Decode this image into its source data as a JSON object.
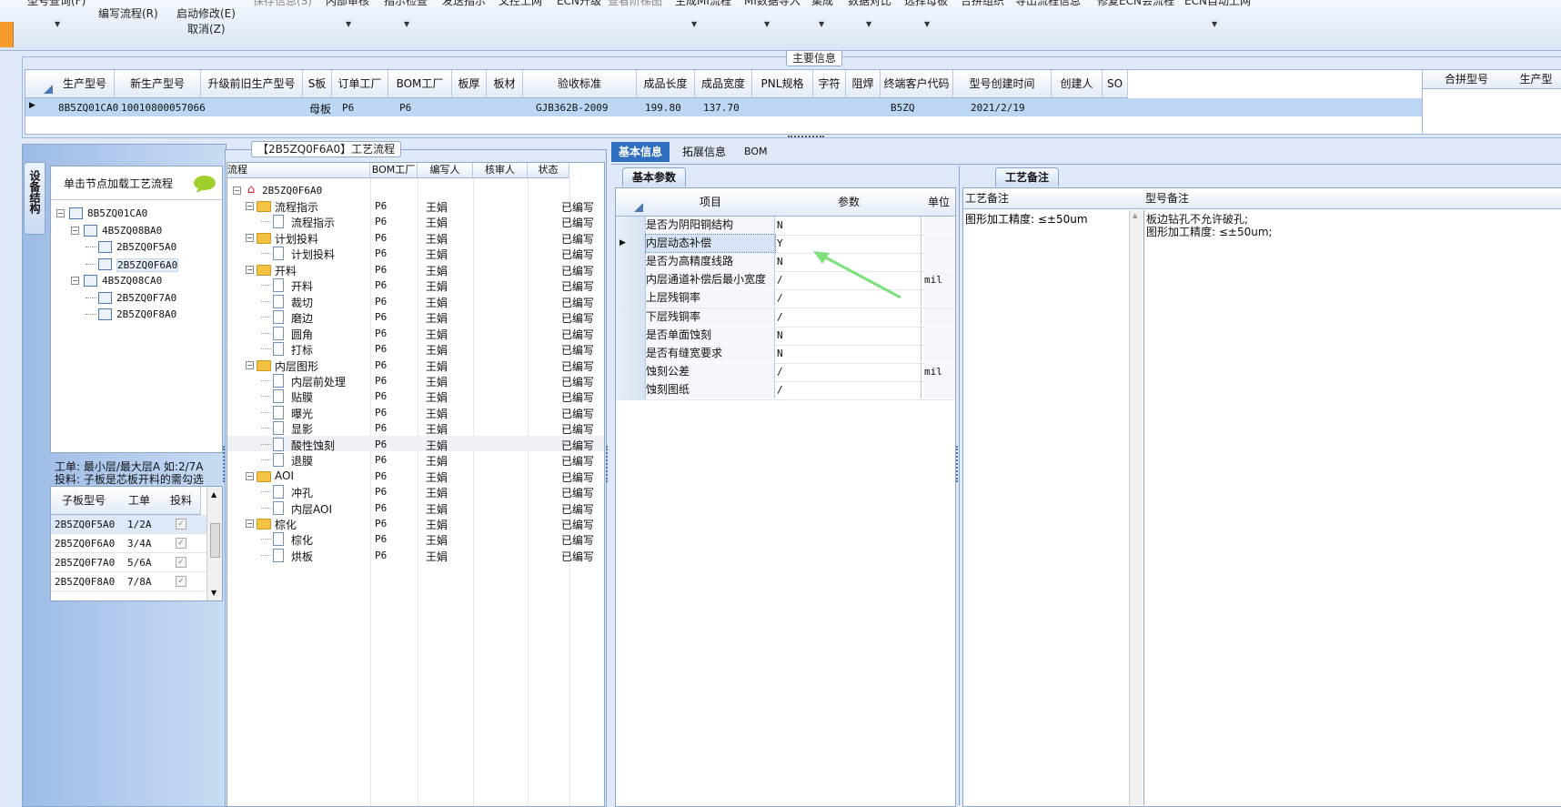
{
  "toolbar": {
    "items": [
      {
        "label": "型号查询(F)",
        "faded": false
      },
      {
        "label": "编写流程(R)",
        "faded": false
      },
      {
        "label": "启动修改(E)",
        "faded": false
      },
      {
        "label": "取消(Z)",
        "faded": false
      },
      {
        "label": "保存信息(S)",
        "faded": true
      },
      {
        "label": "内部审核",
        "faded": false
      },
      {
        "label": "指示检查",
        "faded": false
      },
      {
        "label": "发送指示",
        "faded": false
      },
      {
        "label": "文控上网",
        "faded": false
      },
      {
        "label": "ECN升级",
        "faded": false
      },
      {
        "label": "查看阶梯图",
        "faded": true
      },
      {
        "label": "生成MI流程",
        "faded": false
      },
      {
        "label": "MI数据导入",
        "faded": false
      },
      {
        "label": "集成",
        "faded": false
      },
      {
        "label": "数据对比",
        "faded": false
      },
      {
        "label": "选择母板",
        "faded": false
      },
      {
        "label": "合拼组织",
        "faded": false
      },
      {
        "label": "导出流程信息",
        "faded": false
      },
      {
        "label": "修复ECN会流程",
        "faded": false
      },
      {
        "label": "ECN自动上网",
        "faded": false
      }
    ]
  },
  "main_info": {
    "title": "主要信息",
    "columns": [
      "生产型号",
      "新生产型号",
      "升级前旧生产型号",
      "S板",
      "订单工厂",
      "BOM工厂",
      "板厚",
      "板材",
      "验收标准",
      "成品长度",
      "成品宽度",
      "PNL规格",
      "字符",
      "阻焊",
      "终端客户代码",
      "型号创建时间",
      "创建人",
      "SO"
    ],
    "row": {
      "生产型号": "8B5ZQ01CA0",
      "新生产型号": "10010800057066",
      "升级前旧生产型号": "",
      "S板": "母板",
      "订单工厂": "P6",
      "BOM工厂": "P6",
      "板厚": "",
      "板材": "",
      "验收标准": "GJB362B-2009",
      "成品长度": "199.80",
      "成品宽度": "137.70",
      "PNL规格": "",
      "字符": "",
      "阻焊": "",
      "终端客户代码": "B5ZQ",
      "型号创建时间": "2021/2/19",
      "创建人": "",
      "SO": ""
    },
    "right_columns": [
      "合拼型号",
      "生产型"
    ]
  },
  "structure": {
    "vertical_tab": "设备结构",
    "header_text": "单击节点加载工艺流程",
    "tree": [
      {
        "label": "8B5ZQ01CA0",
        "level": 0
      },
      {
        "label": "4B5ZQ08BA0",
        "level": 1
      },
      {
        "label": "2B5ZQ0F5A0",
        "level": 2
      },
      {
        "label": "2B5ZQ0F6A0",
        "level": 2
      },
      {
        "label": "4B5ZQ08CA0",
        "level": 1
      },
      {
        "label": "2B5ZQ0F7A0",
        "level": 2
      },
      {
        "label": "2B5ZQ0F8A0",
        "level": 2
      }
    ],
    "note1": "工单: 最小层/最大层A 如:2/7A",
    "note2": "投料: 子板是芯板开料的需勾选",
    "sub_columns": [
      "子板型号",
      "工单",
      "投料"
    ],
    "sub_rows": [
      {
        "model": "2B5ZQ0F5A0",
        "order": "1/2A"
      },
      {
        "model": "2B5ZQ0F6A0",
        "order": "3/4A"
      },
      {
        "model": "2B5ZQ0F7A0",
        "order": "5/6A"
      },
      {
        "model": "2B5ZQ0F8A0",
        "order": "7/8A"
      }
    ]
  },
  "process": {
    "title": "【2B5ZQ0F6A0】工艺流程",
    "columns": [
      "流程",
      "BOM工厂",
      "编写人",
      "核审人",
      "状态"
    ],
    "root": "2B5ZQ0F6A0",
    "rows": [
      {
        "name": "流程指示",
        "type": "folder",
        "bom": "P6",
        "writer": "王娟",
        "status": "已编写"
      },
      {
        "name": "流程指示",
        "type": "doc",
        "bom": "P6",
        "writer": "王娟",
        "status": "已编写"
      },
      {
        "name": "计划投料",
        "type": "folder",
        "bom": "P6",
        "writer": "王娟",
        "status": "已编写"
      },
      {
        "name": "计划投料",
        "type": "doc",
        "bom": "P6",
        "writer": "王娟",
        "status": "已编写"
      },
      {
        "name": "开料",
        "type": "folder",
        "bom": "P6",
        "writer": "王娟",
        "status": "已编写"
      },
      {
        "name": "开料",
        "type": "doc",
        "bom": "P6",
        "writer": "王娟",
        "status": "已编写"
      },
      {
        "name": "裁切",
        "type": "doc",
        "bom": "P6",
        "writer": "王娟",
        "status": "已编写"
      },
      {
        "name": "磨边",
        "type": "doc",
        "bom": "P6",
        "writer": "王娟",
        "status": "已编写"
      },
      {
        "name": "圆角",
        "type": "doc",
        "bom": "P6",
        "writer": "王娟",
        "status": "已编写"
      },
      {
        "name": "打标",
        "type": "doc",
        "bom": "P6",
        "writer": "王娟",
        "status": "已编写"
      },
      {
        "name": "内层图形",
        "type": "folder",
        "bom": "P6",
        "writer": "王娟",
        "status": "已编写"
      },
      {
        "name": "内层前处理",
        "type": "doc",
        "bom": "P6",
        "writer": "王娟",
        "status": "已编写"
      },
      {
        "name": "贴膜",
        "type": "doc",
        "bom": "P6",
        "writer": "王娟",
        "status": "已编写"
      },
      {
        "name": "曝光",
        "type": "doc",
        "bom": "P6",
        "writer": "王娟",
        "status": "已编写"
      },
      {
        "name": "显影",
        "type": "doc",
        "bom": "P6",
        "writer": "王娟",
        "status": "已编写"
      },
      {
        "name": "酸性蚀刻",
        "type": "doc",
        "bom": "P6",
        "writer": "王娟",
        "status": "已编写"
      },
      {
        "name": "退膜",
        "type": "doc",
        "bom": "P6",
        "writer": "王娟",
        "status": "已编写"
      },
      {
        "name": "AOI",
        "type": "folder",
        "bom": "P6",
        "writer": "王娟",
        "status": "已编写"
      },
      {
        "name": "冲孔",
        "type": "doc",
        "bom": "P6",
        "writer": "王娟",
        "status": "已编写"
      },
      {
        "name": "内层AOI",
        "type": "doc",
        "bom": "P6",
        "writer": "王娟",
        "status": "已编写"
      },
      {
        "name": "棕化",
        "type": "folder",
        "bom": "P6",
        "writer": "王娟",
        "status": "已编写"
      },
      {
        "name": "棕化",
        "type": "doc",
        "bom": "P6",
        "writer": "王娟",
        "status": "已编写"
      },
      {
        "name": "烘板",
        "type": "doc",
        "bom": "P6",
        "writer": "王娟",
        "status": "已编写"
      }
    ]
  },
  "info_tabs": [
    "基本信息",
    "拓展信息",
    "BOM"
  ],
  "basic_params": {
    "tab": "基本参数",
    "columns": [
      "项目",
      "参数",
      "单位"
    ],
    "rows": [
      {
        "item": "是否为阴阳铜结构",
        "param": "N",
        "unit": ""
      },
      {
        "item": "内层动态补偿",
        "param": "Y",
        "unit": ""
      },
      {
        "item": "是否为高精度线路",
        "param": "N",
        "unit": ""
      },
      {
        "item": "内层通道补偿后最小宽度",
        "param": "/",
        "unit": "mil"
      },
      {
        "item": "上层残铜率",
        "param": "/",
        "unit": ""
      },
      {
        "item": "下层残铜率",
        "param": "/",
        "unit": ""
      },
      {
        "item": "是否单面蚀刻",
        "param": "N",
        "unit": ""
      },
      {
        "item": "是否有缝宽要求",
        "param": "N",
        "unit": ""
      },
      {
        "item": "蚀刻公差",
        "param": "/",
        "unit": "mil"
      },
      {
        "item": "蚀刻图纸",
        "param": "/",
        "unit": ""
      }
    ]
  },
  "remarks": {
    "tab": "工艺备注",
    "col1": "工艺备注",
    "col2": "型号备注",
    "process_note": "图形加工精度: ≤±50um",
    "model_note_1": "板边钻孔不允许破孔;",
    "model_note_2": "图形加工精度: ≤±50um;"
  },
  "colors": {
    "accent": "#2f6fbf",
    "selection": "#bdd7f3",
    "arrow": "#7de07d"
  }
}
